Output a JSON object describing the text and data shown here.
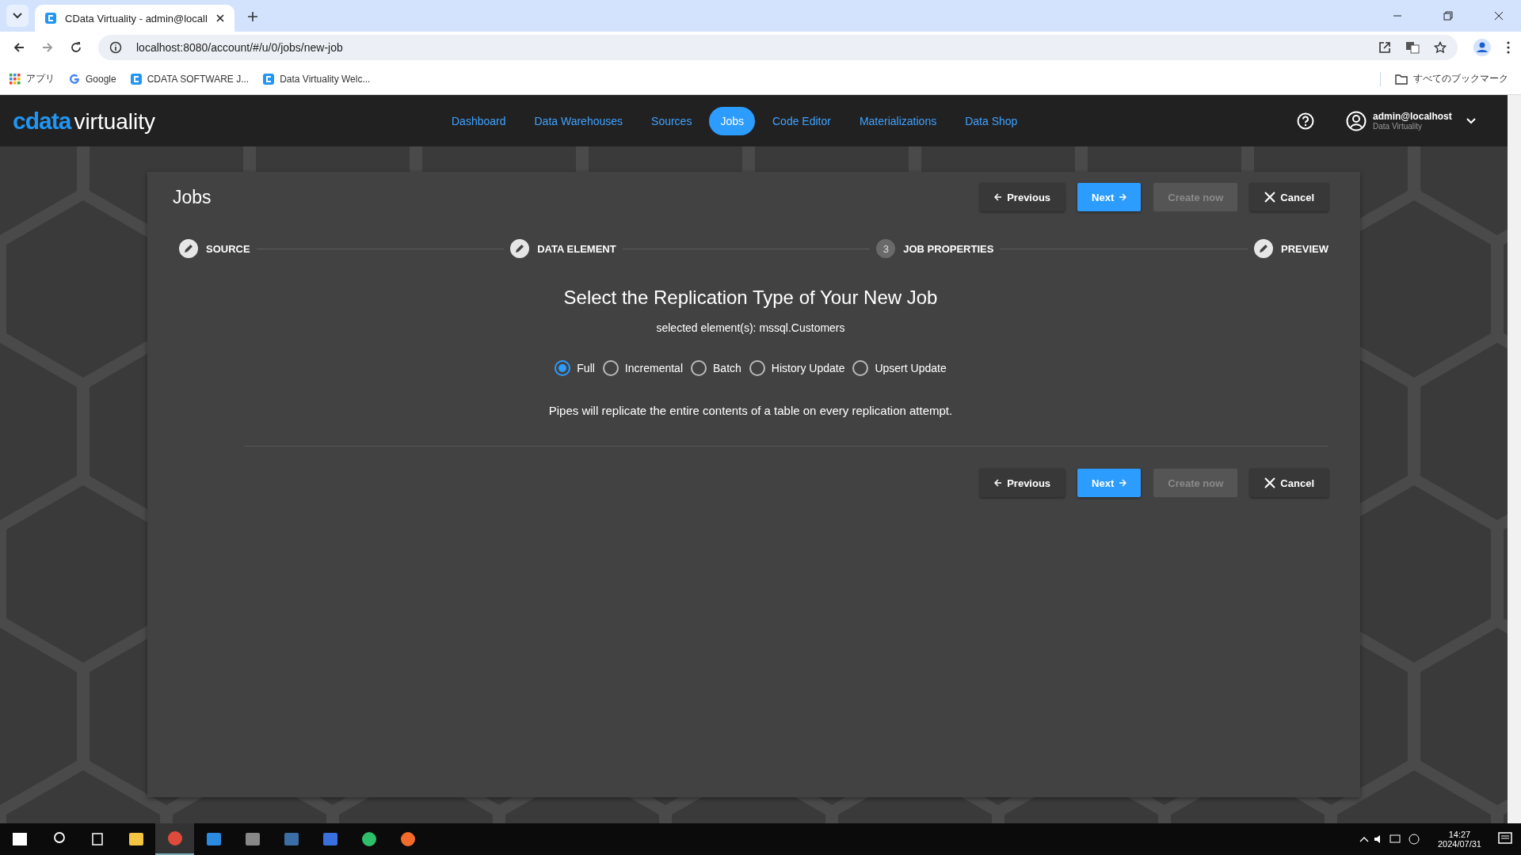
{
  "browser": {
    "tabs": [
      {
        "title": "CData Virtuality - admin@locall",
        "selected": true
      }
    ],
    "address": "localhost:8080/account/#/u/0/jobs/new-job",
    "bookmarks": [
      {
        "label": "アプリ",
        "kind": "apps"
      },
      {
        "label": "Google",
        "kind": "google"
      },
      {
        "label": "CDATA SOFTWARE J...",
        "kind": "cdata"
      },
      {
        "label": "Data Virtuality Welc...",
        "kind": "cdata"
      }
    ],
    "all_bookmarks": "すべてのブックマーク"
  },
  "header": {
    "logo_mark": "cdata",
    "logo_text": "virtuality",
    "nav": [
      {
        "label": "Dashboard",
        "selected": false
      },
      {
        "label": "Data Warehouses",
        "selected": false
      },
      {
        "label": "Sources",
        "selected": false
      },
      {
        "label": "Jobs",
        "selected": true
      },
      {
        "label": "Code Editor",
        "selected": false
      },
      {
        "label": "Materializations",
        "selected": false
      },
      {
        "label": "Data Shop",
        "selected": false
      }
    ],
    "user": {
      "name": "admin@localhost",
      "org": "Data Virtuality"
    }
  },
  "page": {
    "title": "Jobs",
    "top_buttons": [
      {
        "label": "Previous",
        "kind": "previous",
        "disabled": false
      },
      {
        "label": "Next",
        "kind": "next",
        "disabled": false
      },
      {
        "label": "Create now",
        "kind": "plain",
        "disabled": true
      },
      {
        "label": "Cancel",
        "kind": "cancel",
        "disabled": false
      }
    ],
    "steps": [
      {
        "label": "SOURCE",
        "done": true
      },
      {
        "label": "DATA ELEMENT",
        "done": true
      },
      {
        "label": "JOB PROPERTIES",
        "done": false,
        "number": "3"
      },
      {
        "label": "PREVIEW",
        "done": true
      }
    ],
    "heading": "Select the Replication Type of Your New Job",
    "subtitle": "selected element(s): mssql.Customers",
    "options": [
      {
        "label": "Full",
        "selected": true
      },
      {
        "label": "Incremental",
        "selected": false
      },
      {
        "label": "Batch",
        "selected": false
      },
      {
        "label": "History Update",
        "selected": false
      },
      {
        "label": "Upsert Update",
        "selected": false
      }
    ],
    "description": "Pipes will replicate the entire contents of a table on every replication attempt.",
    "bottom_buttons": [
      {
        "label": "Previous",
        "kind": "previous",
        "disabled": false
      },
      {
        "label": "Next",
        "kind": "next",
        "disabled": false
      },
      {
        "label": "Create now",
        "kind": "plain",
        "disabled": true
      },
      {
        "label": "Cancel",
        "kind": "cancel",
        "disabled": false
      }
    ]
  },
  "taskbar": {
    "time": "14:27",
    "date": "2024/07/31"
  }
}
